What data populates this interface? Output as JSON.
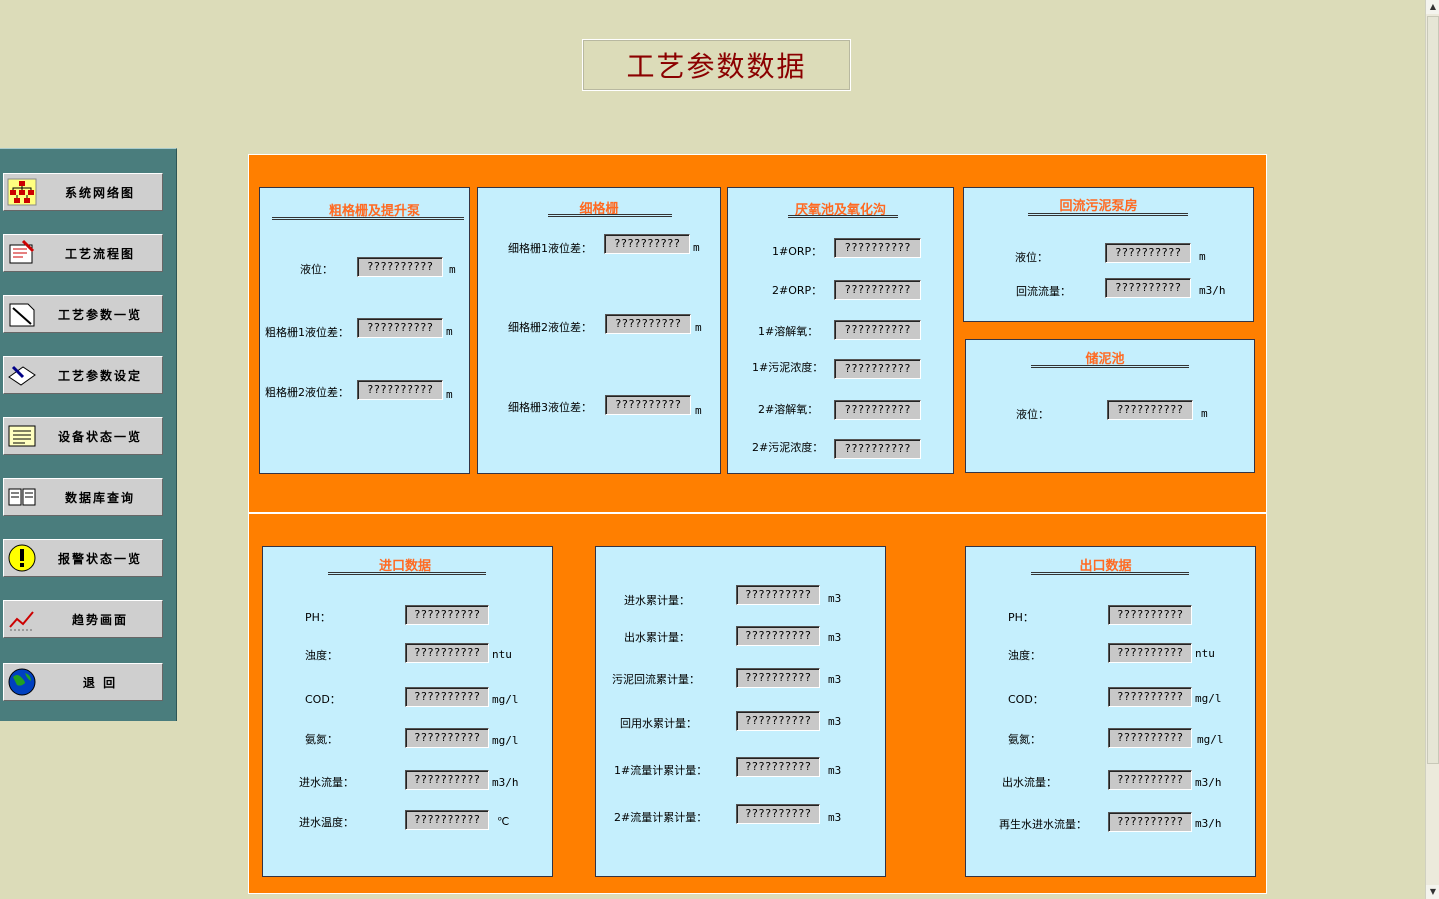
{
  "title": "工艺参数数据",
  "nav": [
    {
      "label": "系统网络图",
      "icon": "network-icon"
    },
    {
      "label": "工艺流程图",
      "icon": "flowchart-icon"
    },
    {
      "label": "工艺参数一览",
      "icon": "document-icon"
    },
    {
      "label": "工艺参数设定",
      "icon": "edit-icon"
    },
    {
      "label": "设备状态一览",
      "icon": "list-icon"
    },
    {
      "label": "数据库查询",
      "icon": "book-icon"
    },
    {
      "label": "报警状态一览",
      "icon": "alert-icon"
    },
    {
      "label": "趋势画面",
      "icon": "trend-icon"
    },
    {
      "label": "退    回",
      "icon": "globe-icon"
    }
  ],
  "placeholder": "??????????",
  "p1": {
    "title": "粗格栅及提升泵",
    "rows": [
      {
        "label": "液位：",
        "unit": "m"
      },
      {
        "label": "粗格栅1液位差：",
        "unit": "m"
      },
      {
        "label": "粗格栅2液位差：",
        "unit": "m"
      }
    ]
  },
  "p2": {
    "title": "细格栅",
    "rows": [
      {
        "label": "细格栅1液位差：",
        "unit": "m"
      },
      {
        "label": "细格栅2液位差：",
        "unit": "m"
      },
      {
        "label": "细格栅3液位差：",
        "unit": "m"
      }
    ]
  },
  "p3": {
    "title": "厌氧池及氧化沟",
    "rows": [
      {
        "label": "1#ORP："
      },
      {
        "label": "2#ORP："
      },
      {
        "label": "1#溶解氧："
      },
      {
        "label": "1#污泥浓度："
      },
      {
        "label": "2#溶解氧："
      },
      {
        "label": "2#污泥浓度："
      }
    ]
  },
  "p4": {
    "title": "回流污泥泵房",
    "rows": [
      {
        "label": "液位：",
        "unit": "m"
      },
      {
        "label": "回流流量：",
        "unit": "m3/h"
      }
    ]
  },
  "p5": {
    "title": "储泥池",
    "rows": [
      {
        "label": "液位：",
        "unit": "m"
      }
    ]
  },
  "p6": {
    "title": "进口数据",
    "rows": [
      {
        "label": "PH：",
        "unit": ""
      },
      {
        "label": "浊度：",
        "unit": "ntu"
      },
      {
        "label": "COD：",
        "unit": "mg/l"
      },
      {
        "label": "氨氮：",
        "unit": "mg/l"
      },
      {
        "label": "进水流量：",
        "unit": "m3/h"
      },
      {
        "label": "进水温度：",
        "unit": "℃"
      }
    ]
  },
  "p7": {
    "rows": [
      {
        "label": "进水累计量：",
        "unit": "m3"
      },
      {
        "label": "出水累计量：",
        "unit": "m3"
      },
      {
        "label": "污泥回流累计量：",
        "unit": "m3"
      },
      {
        "label": "回用水累计量：",
        "unit": "m3"
      },
      {
        "label": "1#流量计累计量：",
        "unit": "m3"
      },
      {
        "label": "2#流量计累计量：",
        "unit": "m3"
      }
    ]
  },
  "p8": {
    "title": "出口数据",
    "rows": [
      {
        "label": "PH：",
        "unit": ""
      },
      {
        "label": "浊度：",
        "unit": "ntu"
      },
      {
        "label": "COD：",
        "unit": "mg/l"
      },
      {
        "label": "氨氮：",
        "unit": "mg/l"
      },
      {
        "label": "出水流量：",
        "unit": "m3/h"
      },
      {
        "label": "再生水进水流量：",
        "unit": "m3/h"
      }
    ]
  }
}
